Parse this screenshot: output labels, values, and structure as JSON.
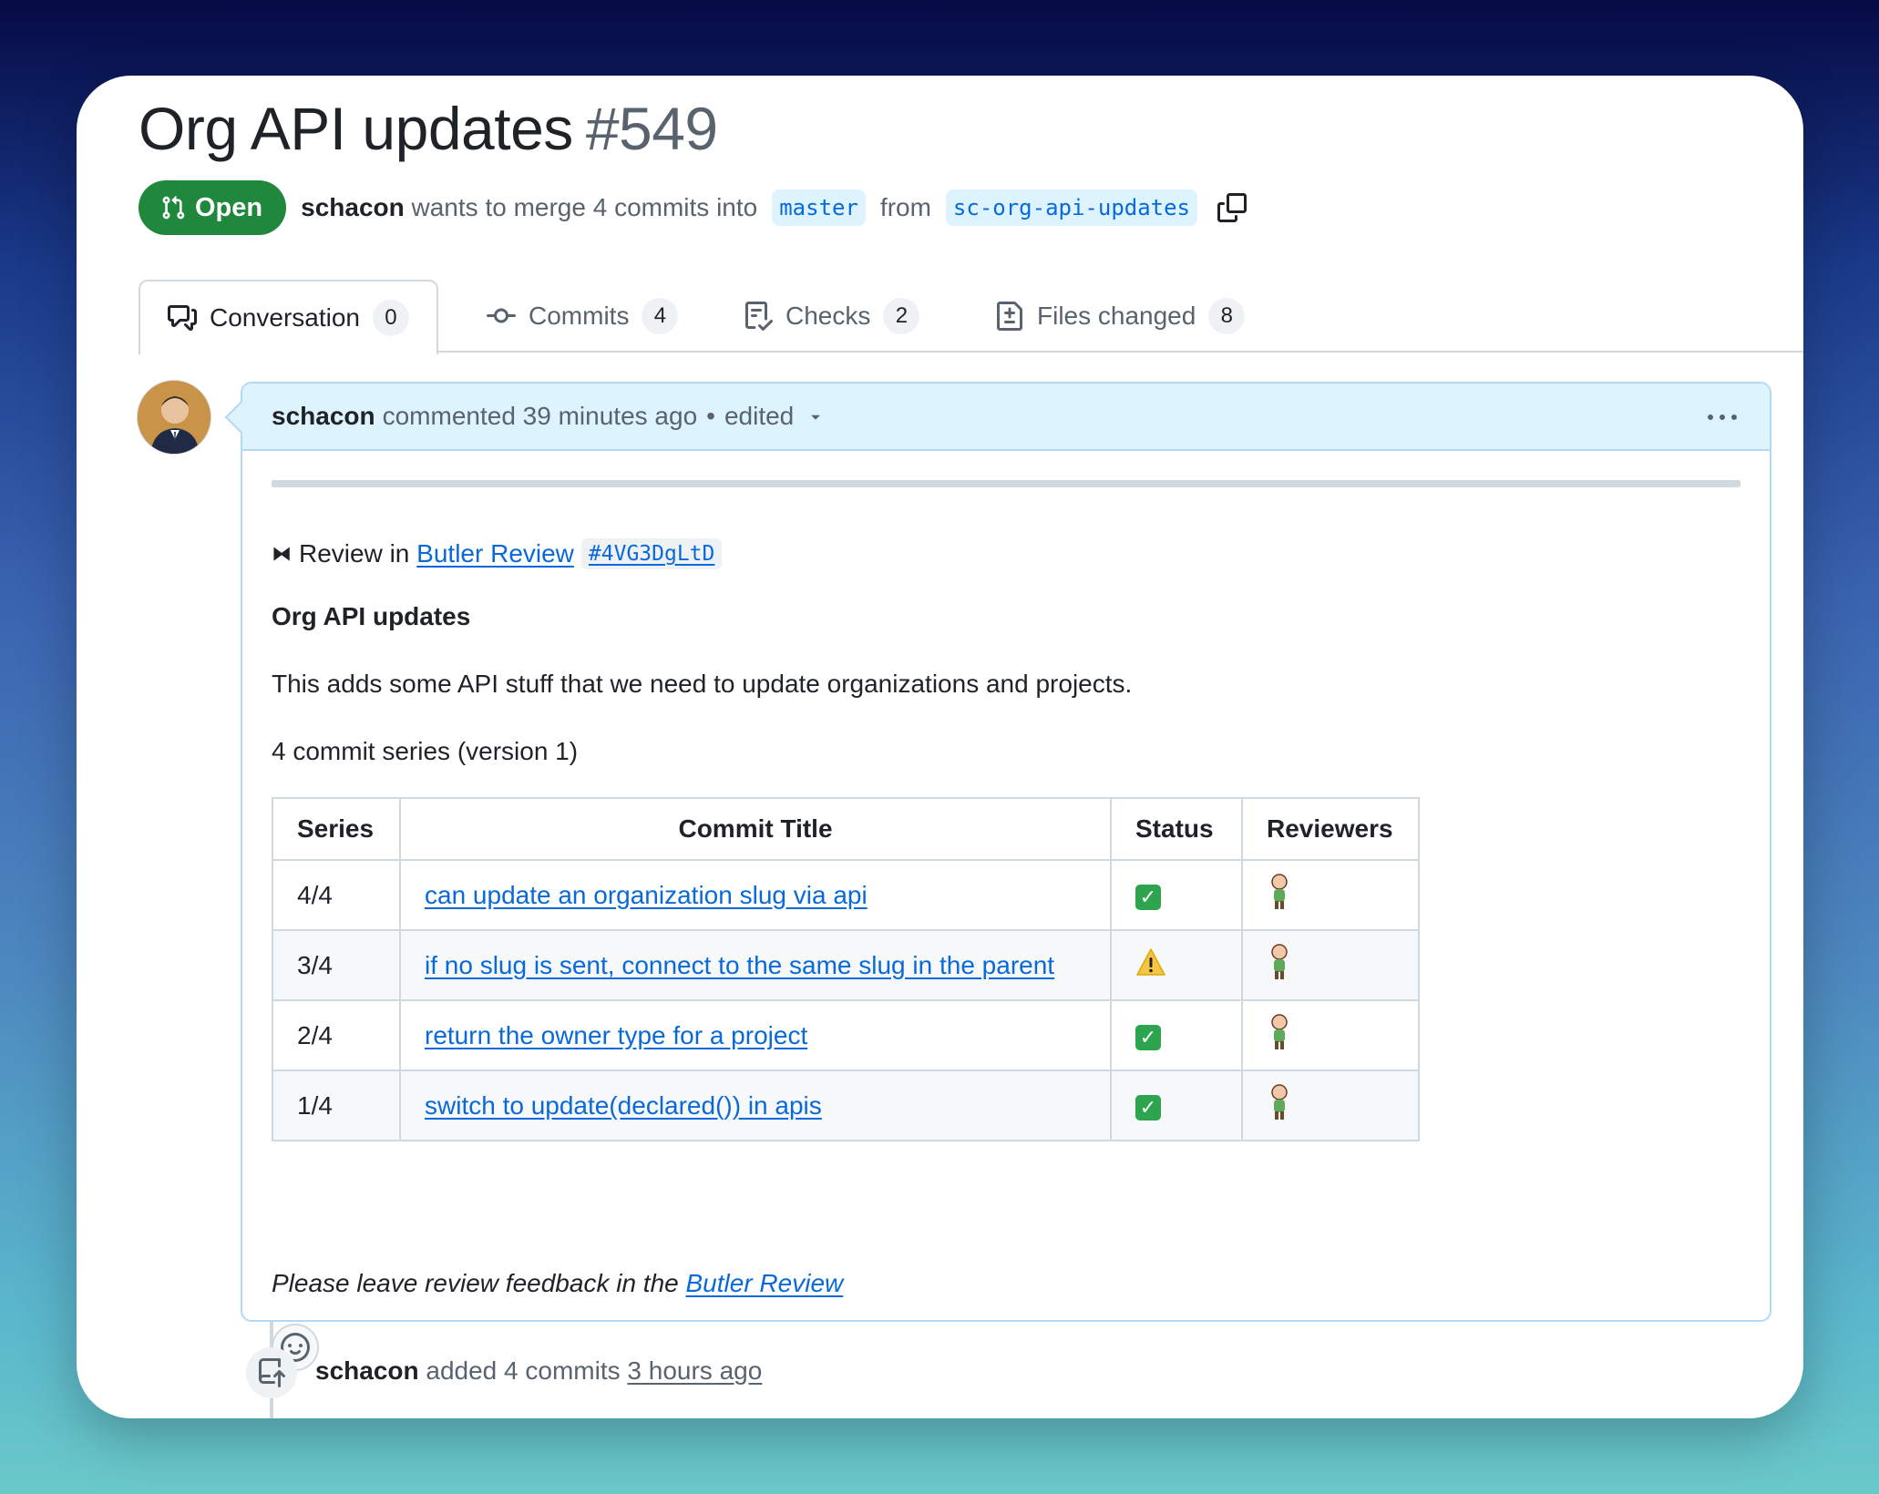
{
  "pr": {
    "title": "Org API updates",
    "number": "#549",
    "state": "Open",
    "author": "schacon",
    "merge_text": "wants to merge 4 commits into",
    "base_branch": "master",
    "from_text": "from",
    "head_branch": "sc-org-api-updates"
  },
  "tabs": [
    {
      "label": "Conversation",
      "count": "0",
      "icon": "comment-discussion-icon"
    },
    {
      "label": "Commits",
      "count": "4",
      "icon": "commit-icon"
    },
    {
      "label": "Checks",
      "count": "2",
      "icon": "checklist-icon"
    },
    {
      "label": "Files changed",
      "count": "8",
      "icon": "file-diff-icon"
    }
  ],
  "comment": {
    "author": "schacon",
    "meta": "commented 39 minutes ago",
    "edited": "edited",
    "review_prefix": "Review in",
    "review_link": "Butler Review",
    "review_code": "#4VG3DgLtD",
    "heading": "Org API updates",
    "description": "This adds some API stuff that we need to update organizations and projects.",
    "series_info": "4 commit series (version 1)",
    "table": {
      "headers": [
        "Series",
        "Commit Title",
        "Status",
        "Reviewers"
      ],
      "rows": [
        {
          "series": "4/4",
          "title": "can update an organization slug via api",
          "status": "check"
        },
        {
          "series": "3/4",
          "title": "if no slug is sent, connect to the same slug in the parent",
          "status": "warning"
        },
        {
          "series": "2/4",
          "title": "return the owner type for a project",
          "status": "check"
        },
        {
          "series": "1/4",
          "title": "switch to update(declared()) in apis",
          "status": "check"
        }
      ]
    },
    "feedback_prefix": "Please leave review feedback in the",
    "feedback_link": "Butler Review"
  },
  "timeline": {
    "author": "schacon",
    "action": "added 4 commits",
    "time": "3 hours ago"
  },
  "colors": {
    "open_green": "#1f883d",
    "link_blue": "#0969da",
    "header_blue": "#ddf4ff"
  }
}
